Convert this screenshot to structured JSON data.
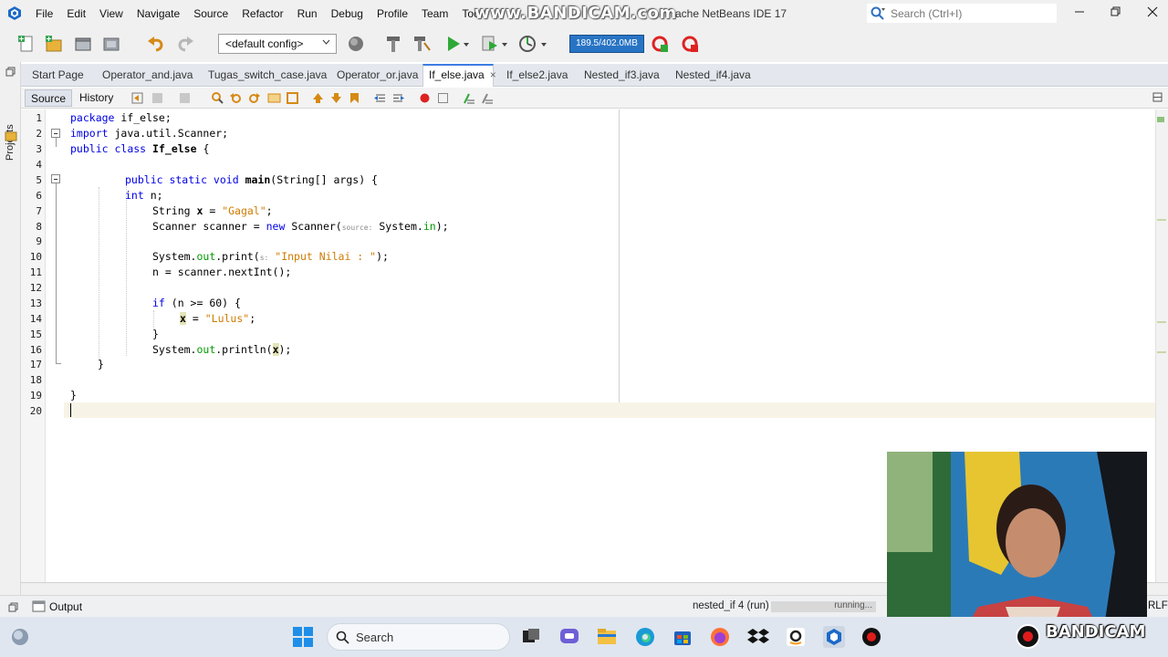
{
  "menubar": {
    "items": [
      "File",
      "Edit",
      "View",
      "Navigate",
      "Source",
      "Refactor",
      "Run",
      "Debug",
      "Profile",
      "Team",
      "Tools"
    ],
    "watermark": "www.BANDICAM.com",
    "window_title": "ache NetBeans IDE 17",
    "search_placeholder": "Search (Ctrl+I)"
  },
  "toolbar": {
    "config_value": "<default config>",
    "memory": "189.5/402.0MB"
  },
  "left_strip": {
    "projects_label": "Projects"
  },
  "tabs": [
    {
      "label": "Start Page"
    },
    {
      "label": "Operator_and.java"
    },
    {
      "label": "Tugas_switch_case.java"
    },
    {
      "label": "Operator_or.java"
    },
    {
      "label": "If_else.java"
    },
    {
      "label": "If_else2.java"
    },
    {
      "label": "Nested_if3.java"
    },
    {
      "label": "Nested_if4.java"
    }
  ],
  "tab_close_glyph": "×",
  "editor_tabs": {
    "source": "Source",
    "history": "History"
  },
  "line_numbers": [
    "1",
    "2",
    "3",
    "4",
    "5",
    "6",
    "7",
    "8",
    "9",
    "10",
    "11",
    "12",
    "13",
    "14",
    "15",
    "16",
    "17",
    "18",
    "19",
    "20"
  ],
  "code": {
    "l1_kw": "package",
    "l1_rest": " if_else;",
    "l2_kw": "import",
    "l2_rest": " java.util.Scanner;",
    "l3_kw1": "public",
    "l3_kw2": "class",
    "l3_name": "If_else",
    "l3_rest": " {",
    "l5_kw": "public static void ",
    "l5_name": "main",
    "l5_rest": "(String[] args) {",
    "l6_kw": "int",
    "l6_rest": " n;",
    "l7_a": "String ",
    "l7_var": "x",
    "l7_b": " = ",
    "l7_str": "\"Gagal\"",
    "l7_c": ";",
    "l8_a": "Scanner scanner = ",
    "l8_kw": "new",
    "l8_b": " Scanner(",
    "l8_hint": "source:",
    "l8_c": " System.",
    "l8_fld": "in",
    "l8_d": ");",
    "l10_a": "System.",
    "l10_fld": "out",
    "l10_b": ".print(",
    "l10_hint": "s:",
    "l10_str": " \"Input Nilai : \"",
    "l10_c": ");",
    "l11": "n = scanner.nextInt();",
    "l13_kw": "if",
    "l13_rest": " (n >= 60) {",
    "l14_var": "x",
    "l14_b": " = ",
    "l14_str": "\"Lulus\"",
    "l14_c": ";",
    "l15": "}",
    "l16_a": "System.",
    "l16_fld": "out",
    "l16_b": ".println(",
    "l16_var": "x",
    "l16_c": ");",
    "l17": "}",
    "l19": "}"
  },
  "output": {
    "label": "Output",
    "run_status": "nested_if 4 (run)",
    "progress_text": "running...",
    "line_ending": "RLF"
  },
  "taskbar": {
    "search_label": "Search",
    "watermark": "BANDICAM"
  },
  "colors": {
    "keyword": "#0000e6",
    "string": "#ce7b00",
    "field": "#009900",
    "tab_accent": "#3d7de0",
    "memory_bg": "#2874c4"
  }
}
